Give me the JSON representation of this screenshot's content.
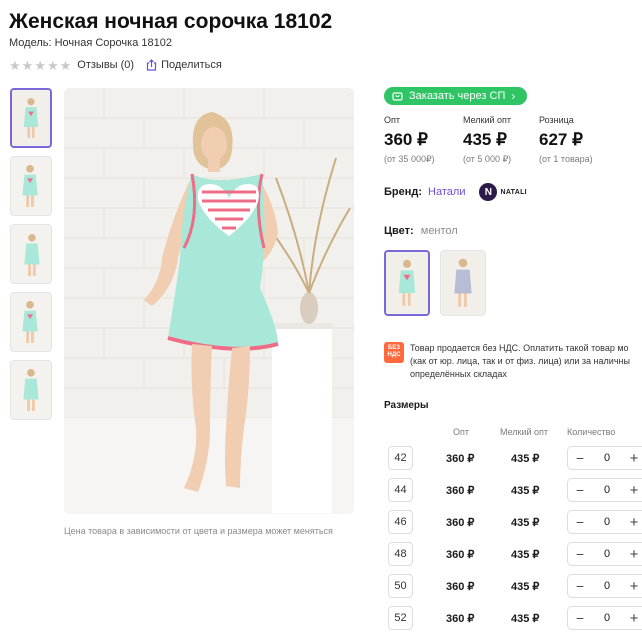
{
  "product": {
    "title": "Женская ночная сорочка 18102",
    "model": "Модель: Ночная Сорочка 18102",
    "reviews": "Отзывы (0)",
    "share": "Поделиться",
    "photo_note": "Цена товара в зависимости от цвета и размера может меняться"
  },
  "sp_button": {
    "label": "Заказать через СП"
  },
  "prices": [
    {
      "label": "Опт",
      "value": "360 ₽",
      "note": "(от 35 000₽)"
    },
    {
      "label": "Мелкий опт",
      "value": "435 ₽",
      "note": "(от 5 000 ₽)"
    },
    {
      "label": "Розница",
      "value": "627 ₽",
      "note": "(от 1 товара)"
    }
  ],
  "brand": {
    "label": "Бренд:",
    "name": "Натали",
    "logo_text": "NATALI"
  },
  "color": {
    "label": "Цвет:",
    "value": "ментол"
  },
  "vat": {
    "badge": "БЕЗ НДС",
    "line1": "Товар продается без НДС. Оплатить такой товар мо",
    "line2": "(как от юр. лица, так и от физ. лица) или за наличны",
    "line3": "определённых складах"
  },
  "sizes": {
    "title": "Размеры",
    "col_opt": "Опт",
    "col_small": "Мелкий опт",
    "col_qty": "Количество",
    "rows": [
      {
        "size": "42",
        "opt": "360 ₽",
        "small": "435 ₽",
        "qty": "0"
      },
      {
        "size": "44",
        "opt": "360 ₽",
        "small": "435 ₽",
        "qty": "0"
      },
      {
        "size": "46",
        "opt": "360 ₽",
        "small": "435 ₽",
        "qty": "0"
      },
      {
        "size": "48",
        "opt": "360 ₽",
        "small": "435 ₽",
        "qty": "0"
      },
      {
        "size": "50",
        "opt": "360 ₽",
        "small": "435 ₽",
        "qty": "0"
      },
      {
        "size": "52",
        "opt": "360 ₽",
        "small": "435 ₽",
        "qty": "0"
      }
    ]
  },
  "colors": {
    "accent": "#7b68d8",
    "green": "#2fc464",
    "dress_mint": "#a9e8d9",
    "trim_pink": "#ee6c86"
  }
}
